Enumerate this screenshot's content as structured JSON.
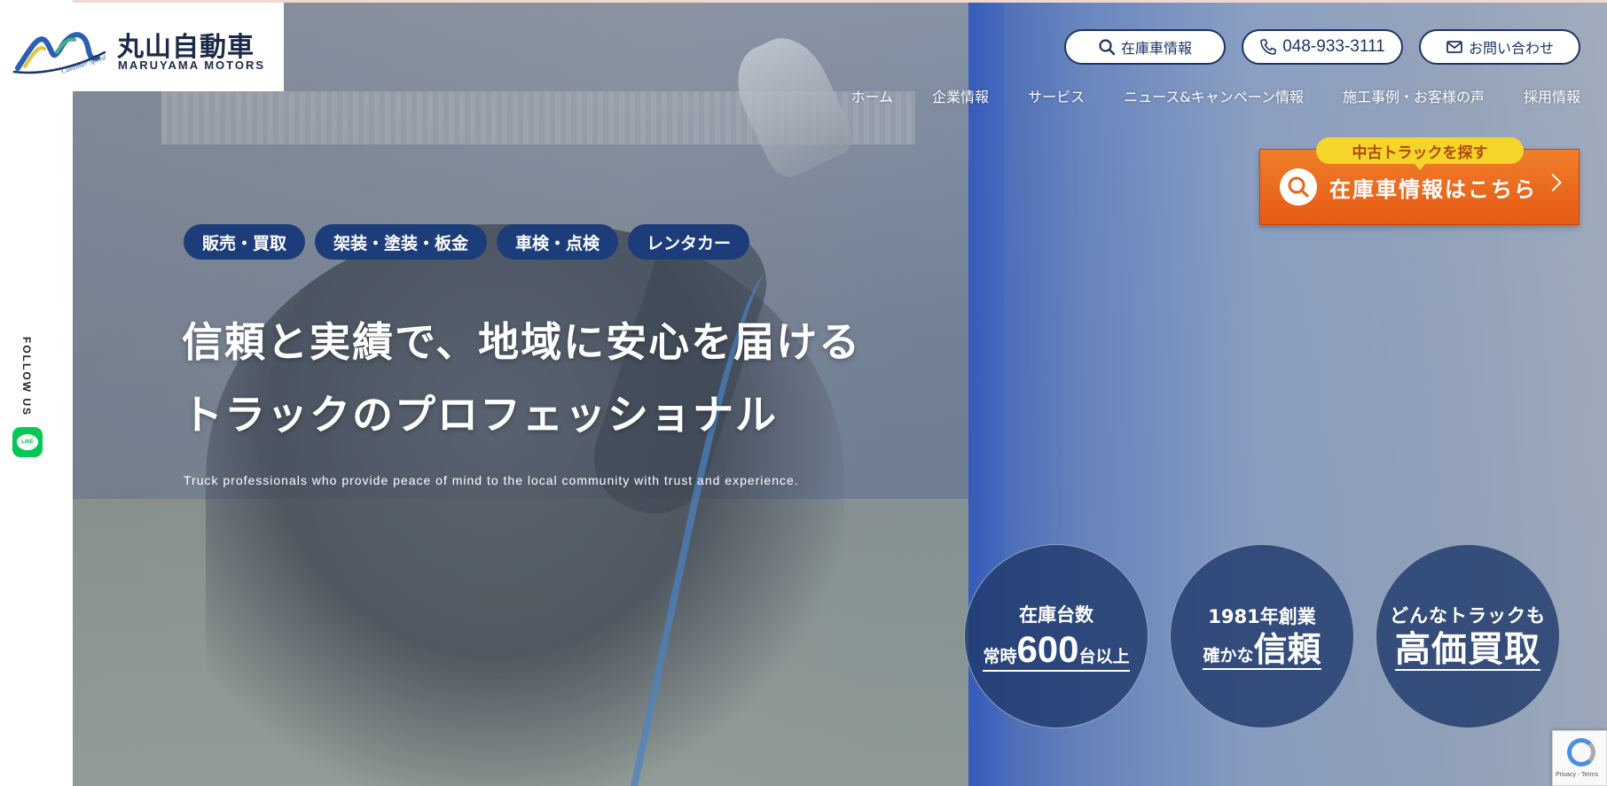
{
  "brand": {
    "name_ja": "丸山自動車",
    "name_en": "MARUYAMA MOTORS",
    "tagline": "Customer Speed",
    "colors": {
      "navy": "#1d3566",
      "orange": "#e9661a",
      "yellow": "#f6d52b",
      "line_green": "#06c755"
    }
  },
  "header": {
    "stock_button": "在庫車情報",
    "phone": "048-933-3111",
    "contact_button": "お問い合わせ"
  },
  "nav": {
    "items": [
      "ホーム",
      "企業情報",
      "サービス",
      "ニュース&キャンペーン情報",
      "施工事例・お客様の声",
      "採用情報"
    ]
  },
  "cta": {
    "tag": "中古トラックを探す",
    "label": "在庫車情報はこちら"
  },
  "side": {
    "follow": "FOLLOW US",
    "line_icon_label": "LINE"
  },
  "hero": {
    "tags": [
      "販売・買取",
      "架装・塗装・板金",
      "車検・点検",
      "レンタカー"
    ],
    "headline_1": "信頼と実績で、地域に安心を届ける",
    "headline_2": "トラックのプロフェッショナル",
    "subline": "Truck professionals who provide peace of mind to the local community with trust and experience."
  },
  "badges": [
    {
      "line1": "在庫台数",
      "pre": "常時",
      "big": "600",
      "post": "台以上"
    },
    {
      "line1": "1981年創業",
      "pre": "確かな",
      "big": "信頼"
    },
    {
      "line1": "どんなトラックも",
      "big": "高価買取"
    }
  ],
  "recaptcha": {
    "text": "Privacy - Terms"
  }
}
